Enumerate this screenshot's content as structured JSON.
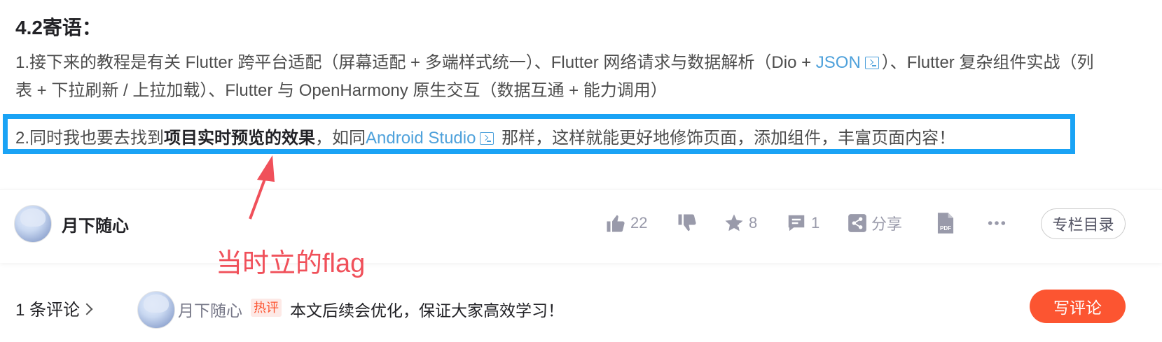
{
  "article": {
    "heading": "4.2寄语：",
    "p1_text1": "1.接下来的教程是有关 Flutter 跨平台适配（屏幕适配 + 多端样式统一）、Flutter 网络请求与数据解析（Dio + ",
    "p1_link": "JSON",
    "p1_text2": "）、Flutter 复杂组件实战（列表 + 下拉刷新 / 上拉加载）、Flutter 与 OpenHarmony 原生交互（数据互通 + 能力调用）",
    "p2_text1": "2.同时我也要去找到",
    "p2_bold": "项目实时预览的效果",
    "p2_text2": "，如同",
    "p2_link": "Android Studio",
    "p2_text3": " 那样，这样就能更好地修饰页面，添加组件，丰富页面内容！"
  },
  "annotation": {
    "note": "当时立的flag",
    "color": "#f0505a",
    "box_color": "#1aa3f5"
  },
  "toolbar": {
    "author": "月下随心",
    "like_count": "22",
    "favorite_count": "8",
    "comment_count": "1",
    "share_label": "分享",
    "pdf_label": "PDF",
    "catalog_label": "专栏目录",
    "icons": [
      "thumbs-up-icon",
      "thumbs-down-icon",
      "star-icon",
      "comment-icon",
      "share-icon",
      "pdf-icon",
      "more-icon"
    ]
  },
  "comments": {
    "count_label": "1 条评论",
    "author": "月下随心",
    "hot_tag": "热评",
    "text": "本文后续会优化，保证大家高效学习！",
    "write_label": "写评论",
    "accent": "#fc5531"
  }
}
